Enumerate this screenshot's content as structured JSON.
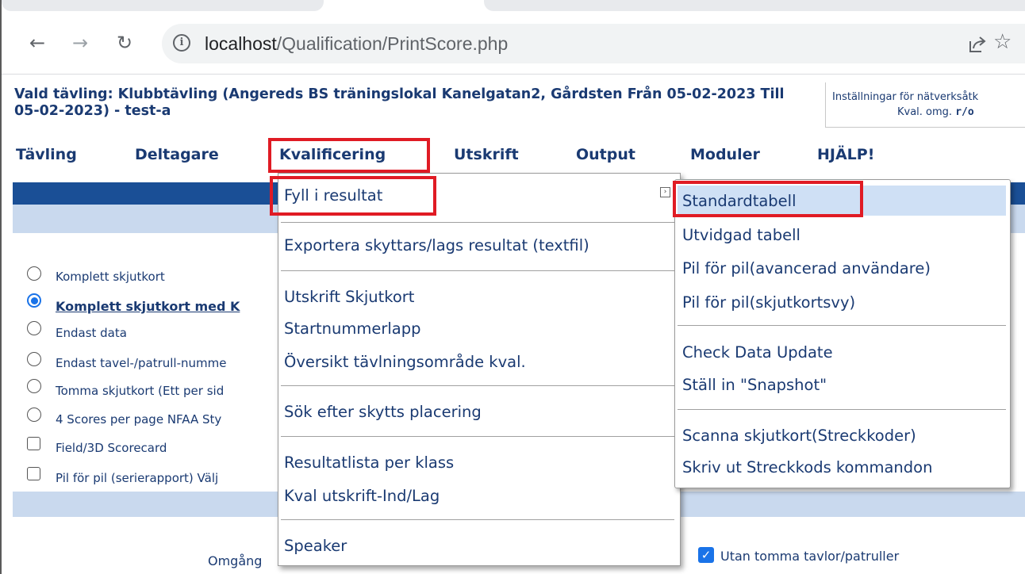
{
  "browser": {
    "url_host": "localhost",
    "url_path": "/Qualification/PrintScore.php"
  },
  "header": {
    "competition_title": "Vald tävling: Klubbtävling (Angereds BS träningslokal Kanelgatan2, Gårdsten Från 05-02-2023 Till 05-02-2023) - test-a",
    "settings_line1": "Inställningar för nätverksåtk",
    "settings_line2_prefix": "Kval. omg.",
    "settings_line2_value": "r/o"
  },
  "menu": {
    "items": [
      "Tävling",
      "Deltagare",
      "Kvalificering",
      "Utskrift",
      "Output",
      "Moduler",
      "HJÄLP!"
    ]
  },
  "dropdown": {
    "items": [
      "Fyll i resultat",
      "Exportera skyttars/lags resultat (textfil)",
      "Utskrift Skjutkort",
      "Startnummerlapp",
      "Översikt tävlningsområde kval.",
      "Sök efter skytts placering",
      "Resultatlista per klass",
      "Kval utskrift-Ind/Lag",
      "Speaker"
    ]
  },
  "submenu": {
    "items": [
      "Standardtabell",
      "Utvidgad tabell",
      "Pil för pil(avancerad användare)",
      "Pil för pil(skjutkortsvy)",
      "Check Data Update",
      "Ställ in \"Snapshot\"",
      "Scanna skjutkort(Streckkoder)",
      "Skriv ut Streckkods kommandon"
    ]
  },
  "options": [
    {
      "type": "radio",
      "label": "Komplett skjutkort",
      "selected": false
    },
    {
      "type": "radio",
      "label": "Komplett skjutkort med K",
      "selected": true
    },
    {
      "type": "radio",
      "label": "Endast data",
      "selected": false
    },
    {
      "type": "radio",
      "label": "Endast tavel-/patrull-numme",
      "selected": false
    },
    {
      "type": "radio",
      "label": "Tomma skjutkort (Ett per sid",
      "selected": false
    },
    {
      "type": "radio",
      "label": "4 Scores per page NFAA Sty",
      "selected": false
    },
    {
      "type": "checkbox",
      "label": "Field/3D Scorecard",
      "checked": false
    },
    {
      "type": "checkbox",
      "label": "Pil för pil (serierapport) Välj",
      "checked": false
    }
  ],
  "bottom": {
    "round_label": "Omgång",
    "checkbox_label": "Utan tomma tavlor/patruller",
    "checkbox_checked": true
  },
  "colors": {
    "text_navy": "#1a3a72",
    "blue_band": "#1a4f96",
    "light_band": "#c9d9ee",
    "highlight_red": "#e01b24",
    "submenu_highlight": "#cfe0f5"
  }
}
